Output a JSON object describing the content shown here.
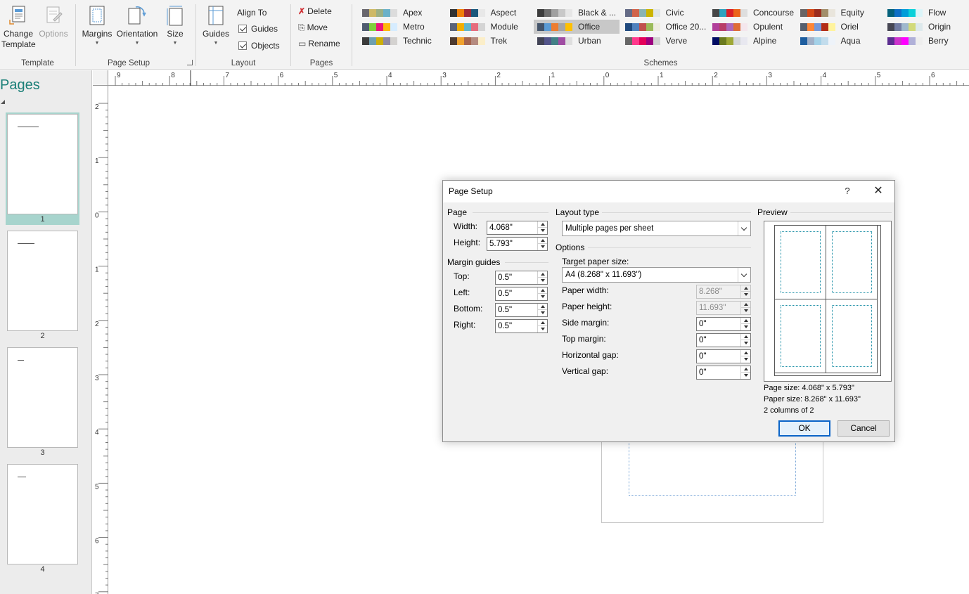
{
  "ribbon": {
    "template_group": {
      "label": "Template",
      "change_template": "Change\nTemplate",
      "change_template_line1": "Change",
      "change_template_line2": "Template",
      "options": "Options"
    },
    "page_setup_group": {
      "label": "Page Setup",
      "margins": "Margins",
      "orientation": "Orientation",
      "size": "Size"
    },
    "layout_group": {
      "label": "Layout",
      "guides": "Guides",
      "align_to": "Align To",
      "guides_check": "Guides",
      "objects_check": "Objects"
    },
    "pages_group": {
      "label": "Pages",
      "delete": "Delete",
      "move": "Move",
      "rename": "Rename"
    },
    "schemes_group": {
      "label": "Schemes",
      "items": [
        {
          "name": "Apex",
          "colors": [
            "#69676d",
            "#ceb966",
            "#9cb084",
            "#6bb1c9",
            "#dcdcdc"
          ]
        },
        {
          "name": "Aspect",
          "colors": [
            "#323232",
            "#f07f09",
            "#9f2936",
            "#1b587c",
            "#e8e8e8"
          ]
        },
        {
          "name": "Black & ...",
          "colors": [
            "#3c3c3c",
            "#6e6e6e",
            "#a0a0a0",
            "#c8c8c8",
            "#e6e6e6"
          ]
        },
        {
          "name": "Civic",
          "colors": [
            "#646b86",
            "#d16349",
            "#8ab4b3",
            "#ccb400",
            "#e0e6e6"
          ]
        },
        {
          "name": "Concourse",
          "colors": [
            "#464646",
            "#2da2bf",
            "#da1f28",
            "#eb641b",
            "#dedede"
          ]
        },
        {
          "name": "Equity",
          "colors": [
            "#696464",
            "#d34817",
            "#9b2d1f",
            "#a28e6a",
            "#e9e5dc"
          ]
        },
        {
          "name": "Flow",
          "colors": [
            "#04617b",
            "#0f6fc6",
            "#009dd9",
            "#0bd0d9",
            "#dbf5f9"
          ]
        },
        {
          "name": "Metro",
          "colors": [
            "#4e5b6f",
            "#7fd13b",
            "#ea157a",
            "#feb80a",
            "#d6ecff"
          ]
        },
        {
          "name": "Module",
          "colors": [
            "#5a6378",
            "#f0ad00",
            "#60b5cc",
            "#e66c7d",
            "#d4d4d4"
          ]
        },
        {
          "name": "Office",
          "colors": [
            "#44546a",
            "#5b9bd5",
            "#ed7d31",
            "#a5a5a5",
            "#ffc000"
          ]
        },
        {
          "name": "Office 20...",
          "colors": [
            "#1f497d",
            "#4f81bd",
            "#c0504d",
            "#9bbb59",
            "#eeece1"
          ]
        },
        {
          "name": "Opulent",
          "colors": [
            "#b13f9a",
            "#b83d68",
            "#ac66bb",
            "#de6c36",
            "#f4e7ed"
          ]
        },
        {
          "name": "Oriel",
          "colors": [
            "#575f6d",
            "#fe8637",
            "#7598d9",
            "#b32c16",
            "#fff39d"
          ]
        },
        {
          "name": "Origin",
          "colors": [
            "#464653",
            "#727ca3",
            "#9fb8cd",
            "#d2da7a",
            "#dde9ec"
          ]
        },
        {
          "name": "Technic",
          "colors": [
            "#3b3b3b",
            "#6ea0b0",
            "#ccaf0a",
            "#8d89a4",
            "#d4d2d0"
          ]
        },
        {
          "name": "Trek",
          "colors": [
            "#4e3b30",
            "#f0a22e",
            "#a5644e",
            "#b58b80",
            "#fbeec9"
          ]
        },
        {
          "name": "Urban",
          "colors": [
            "#424456",
            "#53548a",
            "#438086",
            "#a04da3",
            "#dedede"
          ]
        },
        {
          "name": "Verve",
          "colors": [
            "#666666",
            "#ff388c",
            "#e40059",
            "#9c007f",
            "#d2d2d2"
          ]
        },
        {
          "name": "Alpine",
          "colors": [
            "#000c63",
            "#6b7b1f",
            "#9ea836",
            "#d4d7d9",
            "#e8e8f0"
          ]
        },
        {
          "name": "Aqua",
          "colors": [
            "#1e5e9f",
            "#a0b0c8",
            "#a4d1e8",
            "#c2dcec",
            "#eef3f9"
          ]
        },
        {
          "name": "Berry",
          "colors": [
            "#5b2d90",
            "#cc33cc",
            "#ff00ff",
            "#b0b0d8",
            "#eeeeee"
          ]
        }
      ]
    }
  },
  "pages_pane": {
    "title": "Pages",
    "pages": [
      {
        "number": "1",
        "selected": true
      },
      {
        "number": "2",
        "selected": false
      },
      {
        "number": "3",
        "selected": false
      },
      {
        "number": "4",
        "selected": false
      }
    ]
  },
  "rulers": {
    "horizontal_labels": [
      "9",
      "8",
      "7",
      "6",
      "5",
      "4",
      "3",
      "2",
      "1",
      "0",
      "1",
      "2",
      "3",
      "4",
      "5",
      "6"
    ],
    "vertical_labels": [
      "2",
      "1",
      "0",
      "1",
      "2",
      "3",
      "4",
      "5",
      "6",
      "7"
    ]
  },
  "dialog": {
    "title": "Page Setup",
    "help": "?",
    "close": "✕",
    "page_section": "Page",
    "width_label": "Width:",
    "width_value": "4.068\"",
    "height_label": "Height:",
    "height_value": "5.793\"",
    "margin_guides_section": "Margin guides",
    "top_label": "Top:",
    "top_value": "0.5\"",
    "left_label": "Left:",
    "left_value": "0.5\"",
    "bottom_label": "Bottom:",
    "bottom_value": "0.5\"",
    "right_label": "Right:",
    "right_value": "0.5\"",
    "layout_type_section": "Layout type",
    "layout_type_value": "Multiple pages per sheet",
    "options_section": "Options",
    "target_paper_size_label": "Target paper size:",
    "target_paper_size_value": "A4 (8.268\" x 11.693\")",
    "paper_width_label": "Paper width:",
    "paper_width_value": "8.268\"",
    "paper_height_label": "Paper height:",
    "paper_height_value": "11.693\"",
    "side_margin_label": "Side margin:",
    "side_margin_value": "0\"",
    "top_margin_label": "Top margin:",
    "top_margin_value": "0\"",
    "horizontal_gap_label": "Horizontal gap:",
    "horizontal_gap_value": "0\"",
    "vertical_gap_label": "Vertical gap:",
    "vertical_gap_value": "0\"",
    "preview_section": "Preview",
    "page_size_text": "Page size: 4.068\" x 5.793\"",
    "paper_size_text": "Paper size: 8.268\" x 11.693\"",
    "columns_text": "2 columns of 2",
    "ok": "OK",
    "cancel": "Cancel"
  },
  "colors": {
    "accent_teal": "#1a7f77",
    "selection_highlight": "#a7d4cd",
    "default_button_border": "#0a64c8"
  }
}
